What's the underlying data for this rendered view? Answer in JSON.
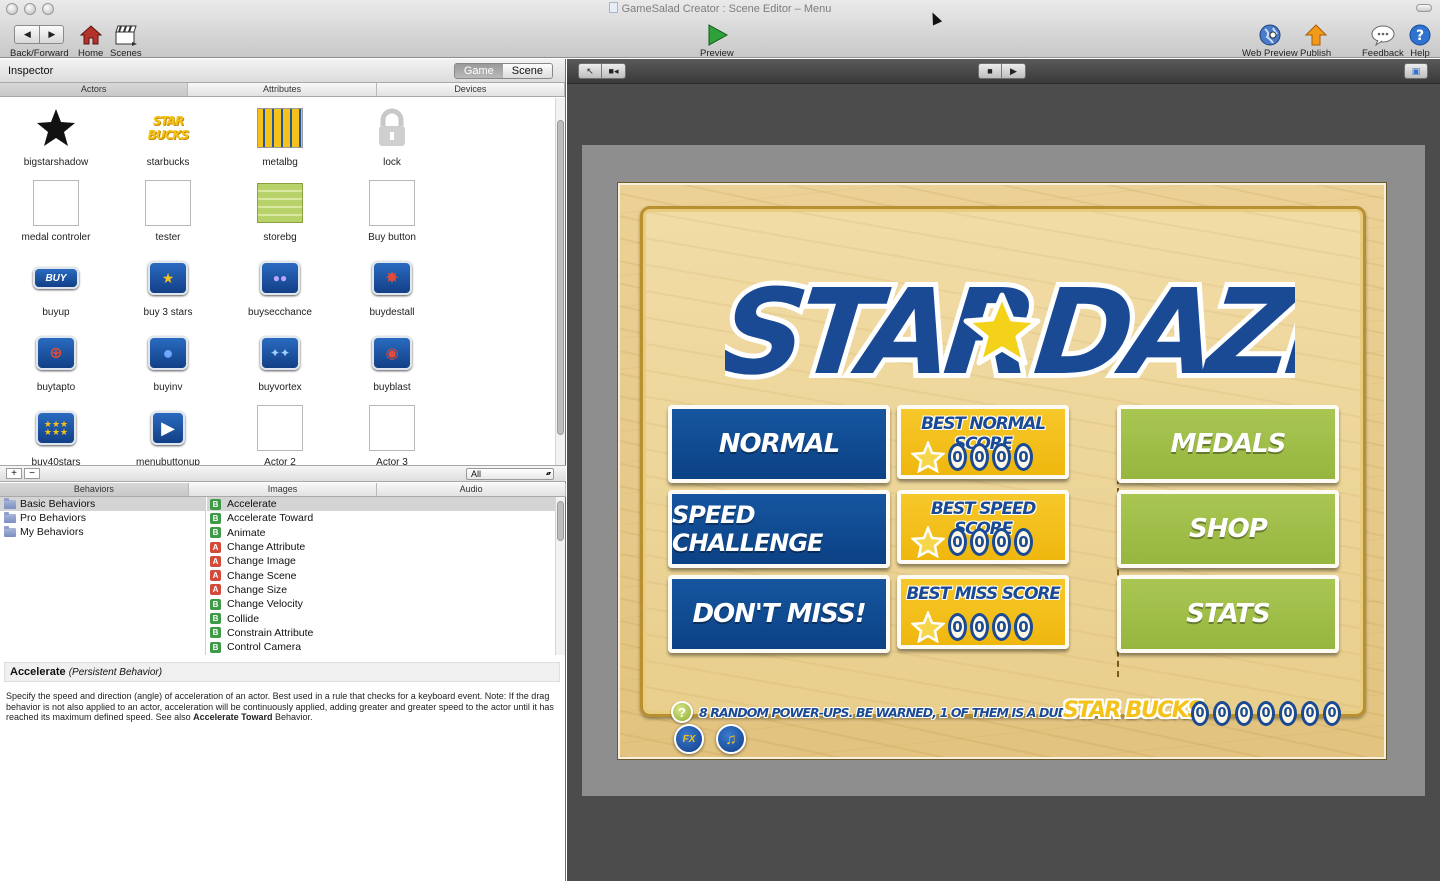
{
  "window": {
    "title": "GameSalad Creator : Scene Editor – Menu"
  },
  "toolbar": {
    "back_forward": "Back/Forward",
    "home": "Home",
    "scenes": "Scenes",
    "preview": "Preview",
    "web_preview": "Web Preview",
    "publish": "Publish",
    "feedback": "Feedback",
    "help": "Help"
  },
  "inspector": {
    "label": "Inspector",
    "mode_game": "Game",
    "mode_scene": "Scene",
    "tabs": [
      "Actors",
      "Attributes",
      "Devices"
    ],
    "filter": "All"
  },
  "actors": [
    {
      "name": "bigstarshadow",
      "icon": "star-shadow"
    },
    {
      "name": "starbucks",
      "icon": "starbucks-logo"
    },
    {
      "name": "metalbg",
      "icon": "metal-bg"
    },
    {
      "name": "lock",
      "icon": "lock"
    },
    {
      "name": "medal controler",
      "icon": "blank"
    },
    {
      "name": "tester",
      "icon": "blank"
    },
    {
      "name": "storebg",
      "icon": "store-bg"
    },
    {
      "name": "Buy button",
      "icon": "blank"
    },
    {
      "name": "buyup",
      "icon": "buy-button"
    },
    {
      "name": "buy 3 stars",
      "icon": "three-stars"
    },
    {
      "name": "buysecchance",
      "icon": "two-balls"
    },
    {
      "name": "buydestall",
      "icon": "destroy-all"
    },
    {
      "name": "buytapto",
      "icon": "target"
    },
    {
      "name": "buyinv",
      "icon": "ball"
    },
    {
      "name": "buyvortex",
      "icon": "vortex"
    },
    {
      "name": "buyblast",
      "icon": "blast"
    },
    {
      "name": "buy40stars",
      "icon": "many-stars"
    },
    {
      "name": "menubuttonup",
      "icon": "play-arrow"
    },
    {
      "name": "Actor 2",
      "icon": "blank"
    },
    {
      "name": "Actor 3",
      "icon": "blank"
    }
  ],
  "library": {
    "tabs": [
      "Behaviors",
      "Images",
      "Audio"
    ],
    "categories": [
      "Basic Behaviors",
      "Pro Behaviors",
      "My Behaviors"
    ],
    "behaviors": [
      {
        "name": "Accelerate",
        "type": "B"
      },
      {
        "name": "Accelerate Toward",
        "type": "B"
      },
      {
        "name": "Animate",
        "type": "B"
      },
      {
        "name": "Change Attribute",
        "type": "A"
      },
      {
        "name": "Change Image",
        "type": "A"
      },
      {
        "name": "Change Scene",
        "type": "A"
      },
      {
        "name": "Change Size",
        "type": "A"
      },
      {
        "name": "Change Velocity",
        "type": "B"
      },
      {
        "name": "Collide",
        "type": "B"
      },
      {
        "name": "Constrain Attribute",
        "type": "B"
      },
      {
        "name": "Control Camera",
        "type": "B"
      }
    ]
  },
  "description": {
    "title": "Accelerate",
    "subtitle": "(Persistent Behavior)",
    "body_pre": "Specify the speed and direction (angle) of acceleration of an actor. Best used in a rule that checks for a keyboard event. Note: If the drag behavior is not also applied to an actor, acceleration will be continuously applied, adding greater and greater speed to the actor until it has reached its maximum defined speed. See also ",
    "body_link": "Accelerate Toward",
    "body_post": " Behavior."
  },
  "scene": {
    "logo_left": "STAR",
    "logo_right": "DAZE",
    "buttons": {
      "normal": "NORMAL",
      "speed": "SPEED CHALLENGE",
      "miss": "DON'T MISS!",
      "medals": "MEDALS",
      "shop": "SHOP",
      "stats": "STATS"
    },
    "scores": [
      {
        "title": "BEST NORMAL SCORE",
        "digits": [
          "0",
          "0",
          "0",
          "0"
        ]
      },
      {
        "title": "BEST SPEED SCORE",
        "digits": [
          "0",
          "0",
          "0",
          "0"
        ]
      },
      {
        "title": "BEST MISS SCORE",
        "digits": [
          "0",
          "0",
          "0",
          "0"
        ]
      }
    ],
    "tip": "8 RANDOM POWER-UPS. BE WARNED, 1 OF THEM IS A DUD!",
    "tip_icon": "?",
    "bucks_label": "STAR BUCKS",
    "bucks_digits": [
      "0",
      "0",
      "0",
      "0",
      "0",
      "0",
      "0"
    ],
    "fx_label": "FX"
  },
  "colors": {
    "brand_blue": "#0c4185",
    "button_green": "#a9c653",
    "score_yellow": "#f7c82a",
    "wood": "#ecd196"
  }
}
